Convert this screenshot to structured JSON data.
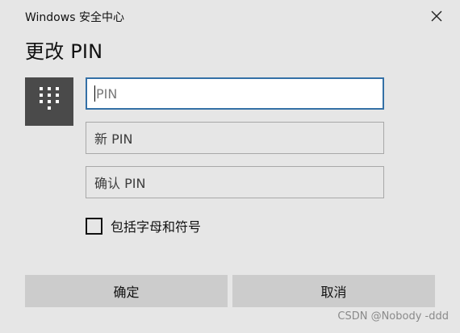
{
  "window": {
    "title": "Windows 安全中心",
    "close_icon": "close-icon"
  },
  "dialog": {
    "heading": "更改 PIN",
    "tile_icon": "keypad-icon"
  },
  "fields": {
    "pin_placeholder": "PIN",
    "new_pin_placeholder": "新 PIN",
    "confirm_pin_placeholder": "确认 PIN"
  },
  "options": {
    "include_letters_label": "包括字母和符号",
    "include_letters_checked": false
  },
  "buttons": {
    "ok_label": "确定",
    "cancel_label": "取消"
  },
  "watermark": "CSDN @Nobody -ddd",
  "colors": {
    "background": "#e6e6e6",
    "tile": "#4a4a4a",
    "focus_border": "#3470a6",
    "button": "#cccccc"
  }
}
